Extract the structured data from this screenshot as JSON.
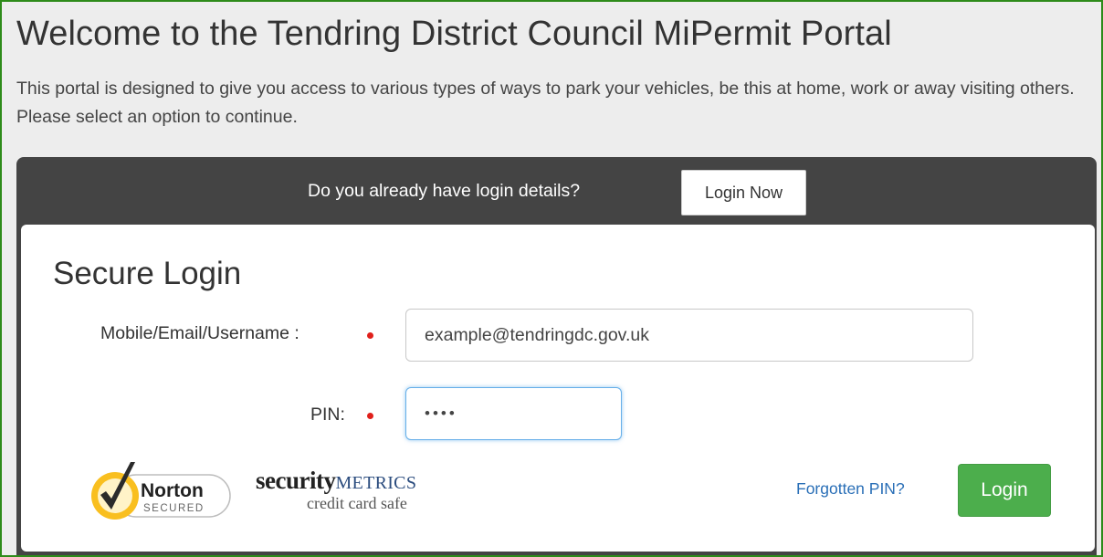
{
  "page": {
    "title": "Welcome to the Tendring District Council MiPermit Portal",
    "intro": "This portal is designed to give you access to various types of ways to park your vehicles, be this at home, work or away visiting others. Please select an option to continue."
  },
  "panel": {
    "question": "Do you already have login details?",
    "login_now_label": "Login Now"
  },
  "login_form": {
    "title": "Secure Login",
    "username_label": "Mobile/Email/Username :",
    "username_value": "example@tendringdc.gov.uk",
    "pin_label": "PIN:",
    "pin_value": "••••",
    "forgot_label": "Forgotten PIN?",
    "login_label": "Login"
  },
  "badges": {
    "norton_top": "Norton",
    "norton_bottom": "SECURED",
    "security_metrics_word1": "security",
    "security_metrics_word2": "METRICS",
    "security_metrics_sub": "credit card safe"
  },
  "colors": {
    "panel_dark": "#444444",
    "login_button": "#4cae4c",
    "required_dot": "#e0201b",
    "link": "#2a6fb7",
    "page_border": "#2e8b1a"
  }
}
